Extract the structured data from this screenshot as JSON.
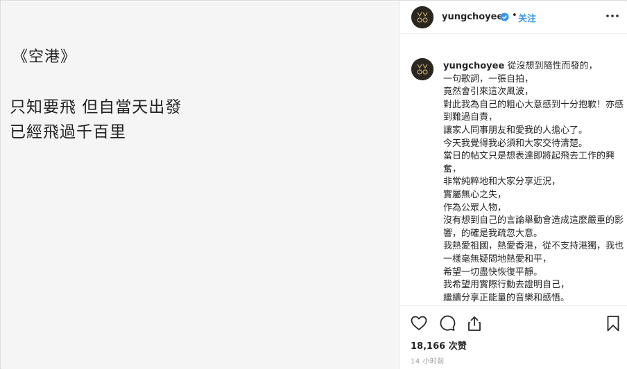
{
  "image": {
    "title": "《空港》",
    "lines": [
      "只知要飛 但自當天出發",
      "已經飛過千百里"
    ]
  },
  "header": {
    "username": "yungchoyee",
    "dot": "•",
    "follow_label": "关注",
    "avatar_icon": "avatar-logo-icon",
    "verified_icon": "verified-badge-icon",
    "more_icon": "more-options-icon"
  },
  "caption": {
    "username": "yungchoyee",
    "text": "從沒想到隨性而發的，\n一句歌詞，一張自拍，\n竟然會引來這次風波，\n對此我為自己的粗心大意感到十分抱歉！亦感到難過自責，\n讓家人同事朋友和愛我的人擔心了。\n今天我覺得我必須和大家交待清楚。\n當日的帖文只是想表達即將起飛去工作的興奮，\n非常純粹地和大家分享近況，\n實屬無心之失，\n作為公眾人物，\n沒有想到自己的言論舉動會造成這麼嚴重的影響，的確是我疏忽大意。\n我熱愛祖國，熱愛香港，從不支持港獨，我也一樣毫無疑問地熱愛和平，\n希望一切盡快恢復平靜。\n我希望用實際行動去證明自己，\n繼續分享正能量的音樂和感悟。\n亦對受事件影響的各方再次深深說一次"
  },
  "actions": {
    "icons": [
      "heart-icon",
      "comment-icon",
      "share-icon",
      "bookmark-icon"
    ],
    "likes": "18,166 次赞",
    "timestamp": "14 小时前"
  },
  "colors": {
    "link_blue": "#3897f0",
    "text": "#262626",
    "muted": "#999999",
    "image_bg": "#f5f5f5"
  }
}
